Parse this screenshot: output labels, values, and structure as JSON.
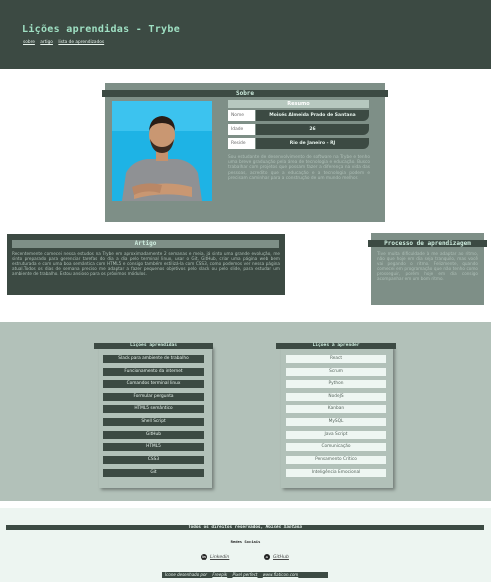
{
  "header": {
    "title": "Lições aprendidas - Trybe",
    "nav": [
      "sobre",
      "artigo",
      "lista de aprendizados"
    ]
  },
  "about": {
    "heading": "Sobre",
    "resume_heading": "Resumo",
    "rows": [
      {
        "key": "Nome",
        "value": "Moisés Almeida Prado de Santana"
      },
      {
        "key": "Idade",
        "value": "26"
      },
      {
        "key": "Reside",
        "value": "Rio de Janeiro - RJ"
      }
    ],
    "bio": "Sou estudante de desenvolvimento de software na Trybe e tenho uma breve graduação pela área de tecnologia e educação. Busco trabalhar com projetos que possam fazer a diferença na vida das pessoas, acredito que a educação e a tecnologia podem e precisam caminhar para a construção de um mundo melhor."
  },
  "artigo": {
    "heading": "Artigo",
    "text": "Recentemente comecei nessa estudos na Trybe em aproximadamente 2 semanas e meia, já sinto uma grande evolução, me sinto preparado para gerenciar tarefas do dia a dia pelo terminal linux, usar o Git, GitHub, criar uma página web bem estruturada e com uma boa semântica com HTML5 e consigo também estilizá-la com CSS3, como podemos ver nessa página atual.Todos os dias de semana preciso me adaptar a fazer pequenos objetivos pelo slack ou pelo slide, para estudar um ambiente de trabalho. Estou ansioso para os próximos módulos."
  },
  "processo": {
    "heading": "Processo de aprendizagem",
    "text": "Tive muita dificuldade à me adaptar ao ritmo, não que hoje em dia seja tranquilo, mas você vai pegando o ritmo. Felizmente, quando comecei em programação que não tenho como prosseguir, porém hoje em dia consigo acompanhar em um bom ritmo."
  },
  "lessons_learned": {
    "heading": "Lições aprendidas",
    "items": [
      "Slack para ambiente de trabalho",
      "Funcionamento da internet",
      "Comandos terminal linux",
      "Formular pergunta",
      "HTML5 semântico",
      "Shell Script",
      "GitHub",
      "HTML5",
      "CSS3",
      "Git"
    ]
  },
  "lessons_to_learn": {
    "heading": "Lições à aprender",
    "items": [
      "React",
      "Scrum",
      "Python",
      "NodeJS",
      "Kanban",
      "MySQL",
      "Java Script",
      "Comunicação",
      "Pensamento Crítico",
      "Inteligência Emocional"
    ]
  },
  "footer": {
    "rights": "Todos os direitos reservados,",
    "author": "Moisés Santana",
    "social_heading": "Redes Sociais",
    "links": [
      {
        "label": "Linkedin",
        "icon": "linkedin-icon"
      },
      {
        "label": "GitHub",
        "icon": "github-icon"
      }
    ],
    "credits_prefix": "Ícone desenhado por",
    "credits_links": [
      "Freepik",
      "Pixel perfect",
      "www.flaticon.com"
    ]
  },
  "colors": {
    "dark": "#3c4a43",
    "mid": "#7e8f87",
    "light": "#b2c1b9",
    "accent": "#9fe0c3",
    "photo_bg": "#1eb3e5"
  }
}
